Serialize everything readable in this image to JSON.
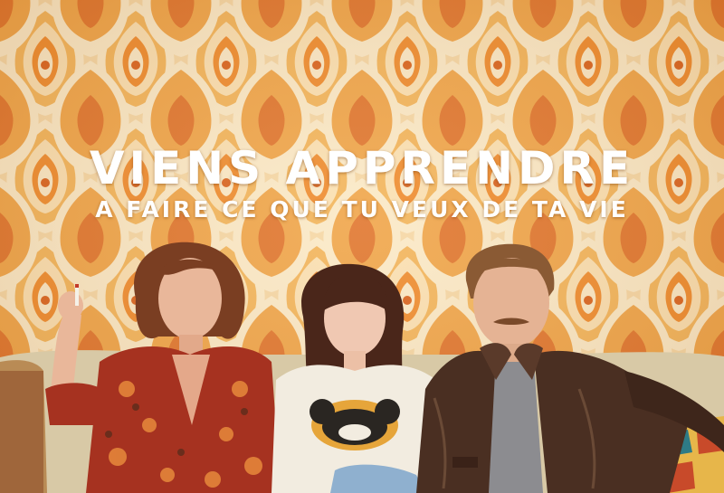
{
  "headline": "VIENS APPRENDRE",
  "tagline": "A FAIRE CE QUE TU VEUX DE TA VIE",
  "colors": {
    "wallpaper_base": "#f6d7a3",
    "wallpaper_orange": "#ef8a2a",
    "wallpaper_deep": "#d9611a",
    "wallpaper_cream": "#fbe9c5",
    "title_text": "#ffffff",
    "jacket_leather": "#4a2f22",
    "robe_pattern": "#b4341f"
  },
  "icons": {
    "wallpaper": "retro-orange-floral-wallpaper",
    "character_left": "woman-patterned-robe-cigarette",
    "character_center": "girl-bangs-mouse-tshirt",
    "character_right": "man-leather-jacket-mustache"
  }
}
